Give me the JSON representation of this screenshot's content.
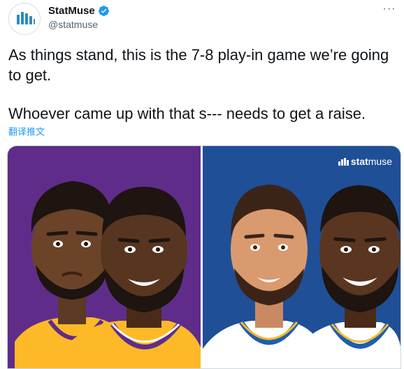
{
  "author": {
    "display_name": "StatMuse",
    "handle": "@statmuse",
    "verified_icon": "verified-badge-icon",
    "avatar_icon": "statmuse-logo-icon"
  },
  "menu": {
    "more_icon": "more-horizontal-icon",
    "more_glyph": "···"
  },
  "tweet": {
    "line1": "As things stand, this is the 7-8 play-in game we’re going to get.",
    "line2": "Whoever came up with that s--- needs to get a raise.",
    "translate_label": "翻译推文"
  },
  "media": {
    "watermark_bold": "stat",
    "watermark_light": "muse",
    "colors": {
      "left_bg": "#5f2d89",
      "right_bg": "#1f4f97",
      "lakers_gold": "#fdb927",
      "warriors_white": "#ffffff",
      "brand_accent": "#1d9bf0"
    }
  }
}
